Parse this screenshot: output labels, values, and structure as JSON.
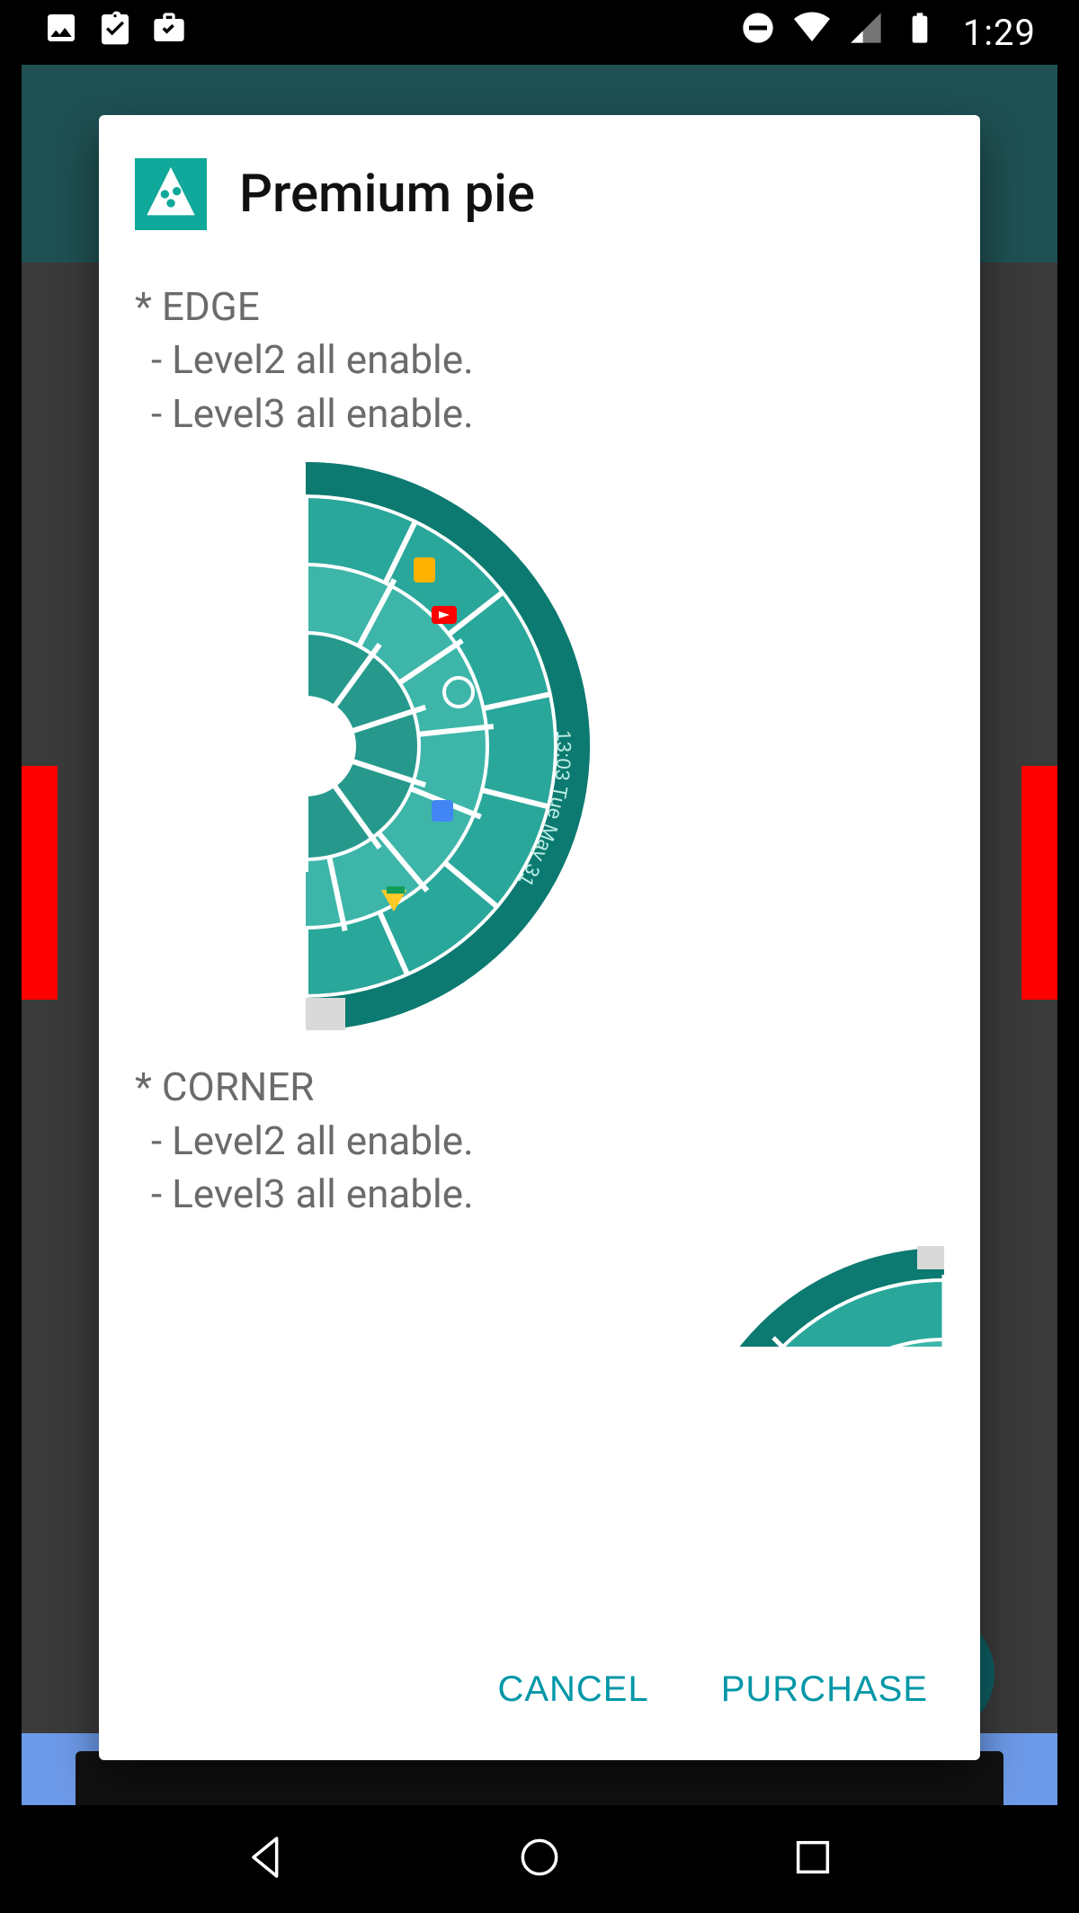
{
  "statusbar": {
    "time": "1:29",
    "icons_left": [
      "gallery-icon",
      "clipboard-check-icon",
      "briefcase-check-icon"
    ],
    "icons_right": [
      "do-not-disturb-icon",
      "wifi-icon",
      "cell-signal-icon",
      "battery-icon"
    ]
  },
  "dialog": {
    "title": "Premium pie",
    "sections": [
      {
        "id": "edge",
        "heading": "* EDGE",
        "lines": [
          " - Level2 all enable.",
          " - Level3 all enable."
        ]
      },
      {
        "id": "corner",
        "heading": "* CORNER",
        "lines": [
          " - Level2 all enable.",
          " - Level3 all enable."
        ]
      }
    ],
    "edge_pie_clock_text": "13:03 Tue May 31",
    "actions": {
      "cancel": "CANCEL",
      "purchase": "PURCHASE"
    }
  },
  "navbar": {
    "buttons": [
      "back",
      "home",
      "recent"
    ]
  }
}
